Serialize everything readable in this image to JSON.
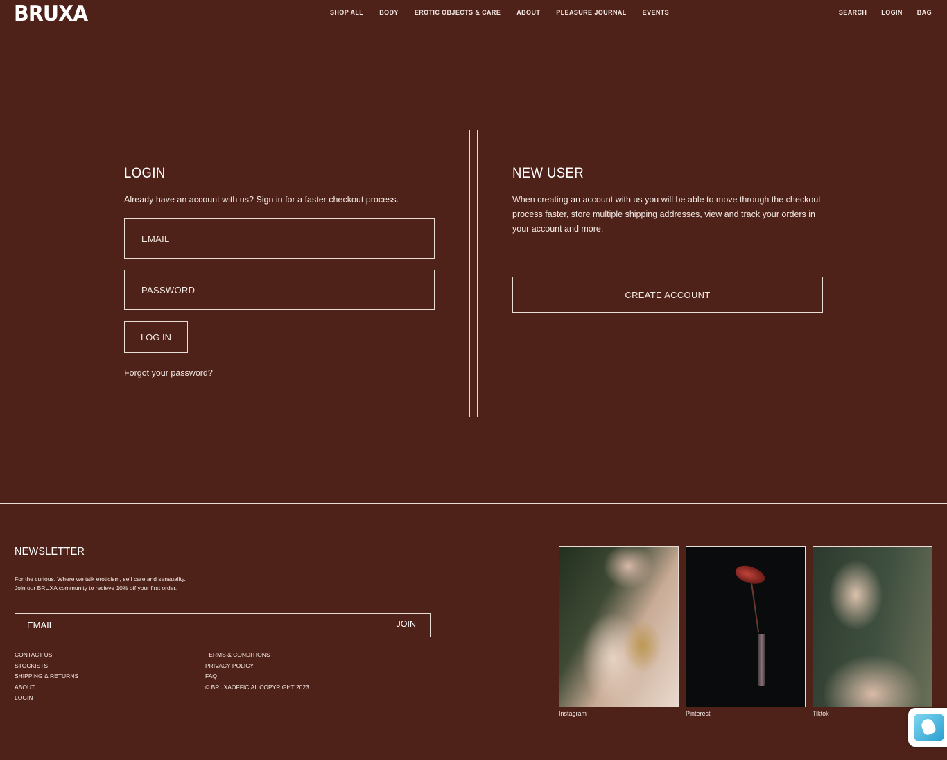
{
  "brand": {
    "logo": "BRUXA"
  },
  "nav": {
    "items": [
      "SHOP ALL",
      "BODY",
      "EROTIC OBJECTS & CARE",
      "ABOUT",
      "PLEASURE JOURNAL",
      "EVENTS"
    ],
    "utility": [
      "SEARCH",
      "LOGIN",
      "BAG"
    ]
  },
  "login": {
    "title": "LOGIN",
    "description": "Already have an account with us? Sign in for a faster checkout process.",
    "email_placeholder": "EMAIL",
    "password_placeholder": "PASSWORD",
    "submit_label": "LOG IN",
    "forgot_label": "Forgot your password?"
  },
  "new_user": {
    "title": "NEW USER",
    "description": "When creating an account with us you will be able to move through the checkout process faster, store multiple shipping addresses, view and track your orders in your account and more.",
    "create_label": "CREATE ACCOUNT"
  },
  "newsletter": {
    "title": "NEWSLETTER",
    "line1": "For the curious. Where we talk eroticism, self care and sensuality.",
    "line2": "Join our BRUXA community to recieve 10% off your first order.",
    "email_placeholder": "EMAIL",
    "join_label": "JOIN"
  },
  "footer": {
    "col1": [
      "CONTACT US",
      "STOCKISTS",
      "SHIPPING & RETURNS",
      "ABOUT",
      "LOGIN"
    ],
    "col2": [
      "TERMS & CONDITIONS",
      "PRIVACY POLICY",
      "FAQ",
      "© BRUXAOFFICIAL COPYRIGHT 2023"
    ]
  },
  "social": {
    "instagram": "Instagram",
    "pinterest": "Pinterest",
    "tiktok": "Tiktok"
  },
  "colors": {
    "background": "#4f2219",
    "text": "#f3e9e4",
    "border": "#e9ddd7"
  }
}
